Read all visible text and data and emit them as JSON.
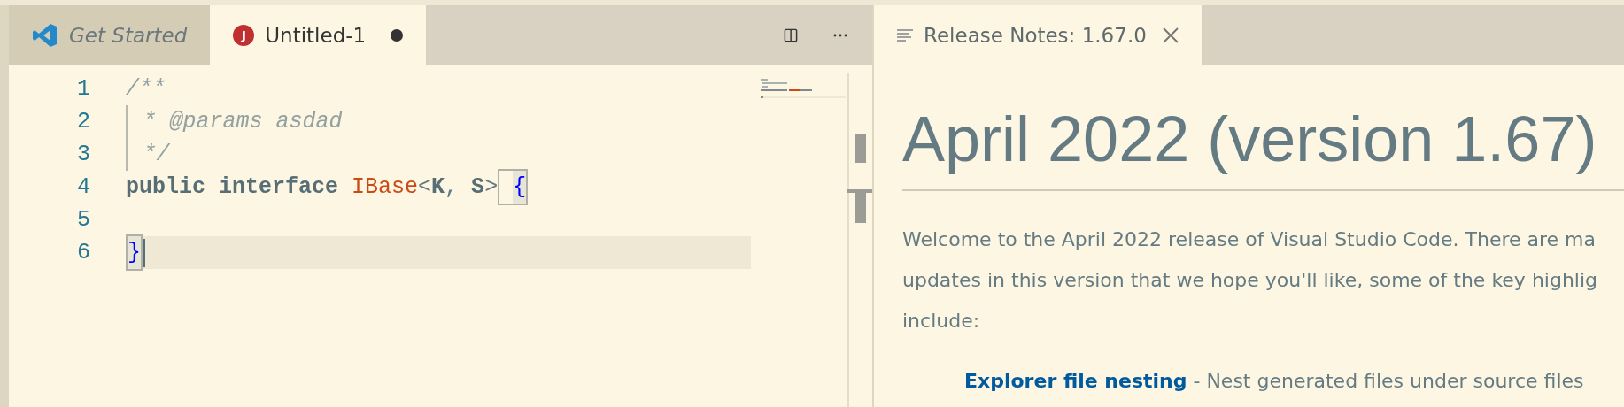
{
  "left_group": {
    "tabs": [
      {
        "label": "Get Started",
        "kind": "welcome",
        "selected": false,
        "dirty": false
      },
      {
        "label": "Untitled-1",
        "kind": "java",
        "icon_letter": "J",
        "selected": true,
        "dirty": true
      }
    ],
    "lines": [
      {
        "number": "1",
        "current": false,
        "indent_guide": false,
        "tokens": [
          {
            "kind": "comment",
            "text": "/**"
          }
        ]
      },
      {
        "number": "2",
        "current": false,
        "indent_guide": true,
        "tokens": [
          {
            "kind": "comment",
            "text": "* @params asdad"
          }
        ]
      },
      {
        "number": "3",
        "current": false,
        "indent_guide": true,
        "tokens": [
          {
            "kind": "comment",
            "text": "*/"
          }
        ]
      },
      {
        "number": "4",
        "current": false,
        "indent_guide": false,
        "tokens": [
          {
            "kind": "keyword",
            "text": "public interface"
          },
          {
            "kind": "type",
            "space_before": true,
            "text": "IBase"
          },
          {
            "kind": "punct",
            "text": "<"
          },
          {
            "kind": "param",
            "text": "K"
          },
          {
            "kind": "punct",
            "text": ","
          },
          {
            "kind": "param",
            "space_before": true,
            "text": "S"
          },
          {
            "kind": "punct",
            "text": ">"
          },
          {
            "kind": "bracket-match",
            "space_before": true,
            "text": "{"
          }
        ]
      },
      {
        "number": "5",
        "current": false,
        "indent_guide": false
      },
      {
        "number": "6",
        "current": true,
        "indent_guide": false,
        "tokens": [
          {
            "kind": "bracket-match",
            "text": "}"
          }
        ]
      }
    ]
  },
  "right_group": {
    "tabs": [
      {
        "label": "Release Notes: 1.67.0",
        "kind": "notes",
        "selected": true,
        "dirty": false
      }
    ],
    "heading": "April 2022 (version 1.67)",
    "paragraph_lines": [
      "Welcome to the April 2022 release of Visual Studio Code. There are ma",
      "updates in this version that we hope you'll like, some of the key highlig",
      "include:"
    ],
    "bullet": {
      "link": "Explorer file nesting",
      "text": " - Nest generated files under source files"
    }
  }
}
